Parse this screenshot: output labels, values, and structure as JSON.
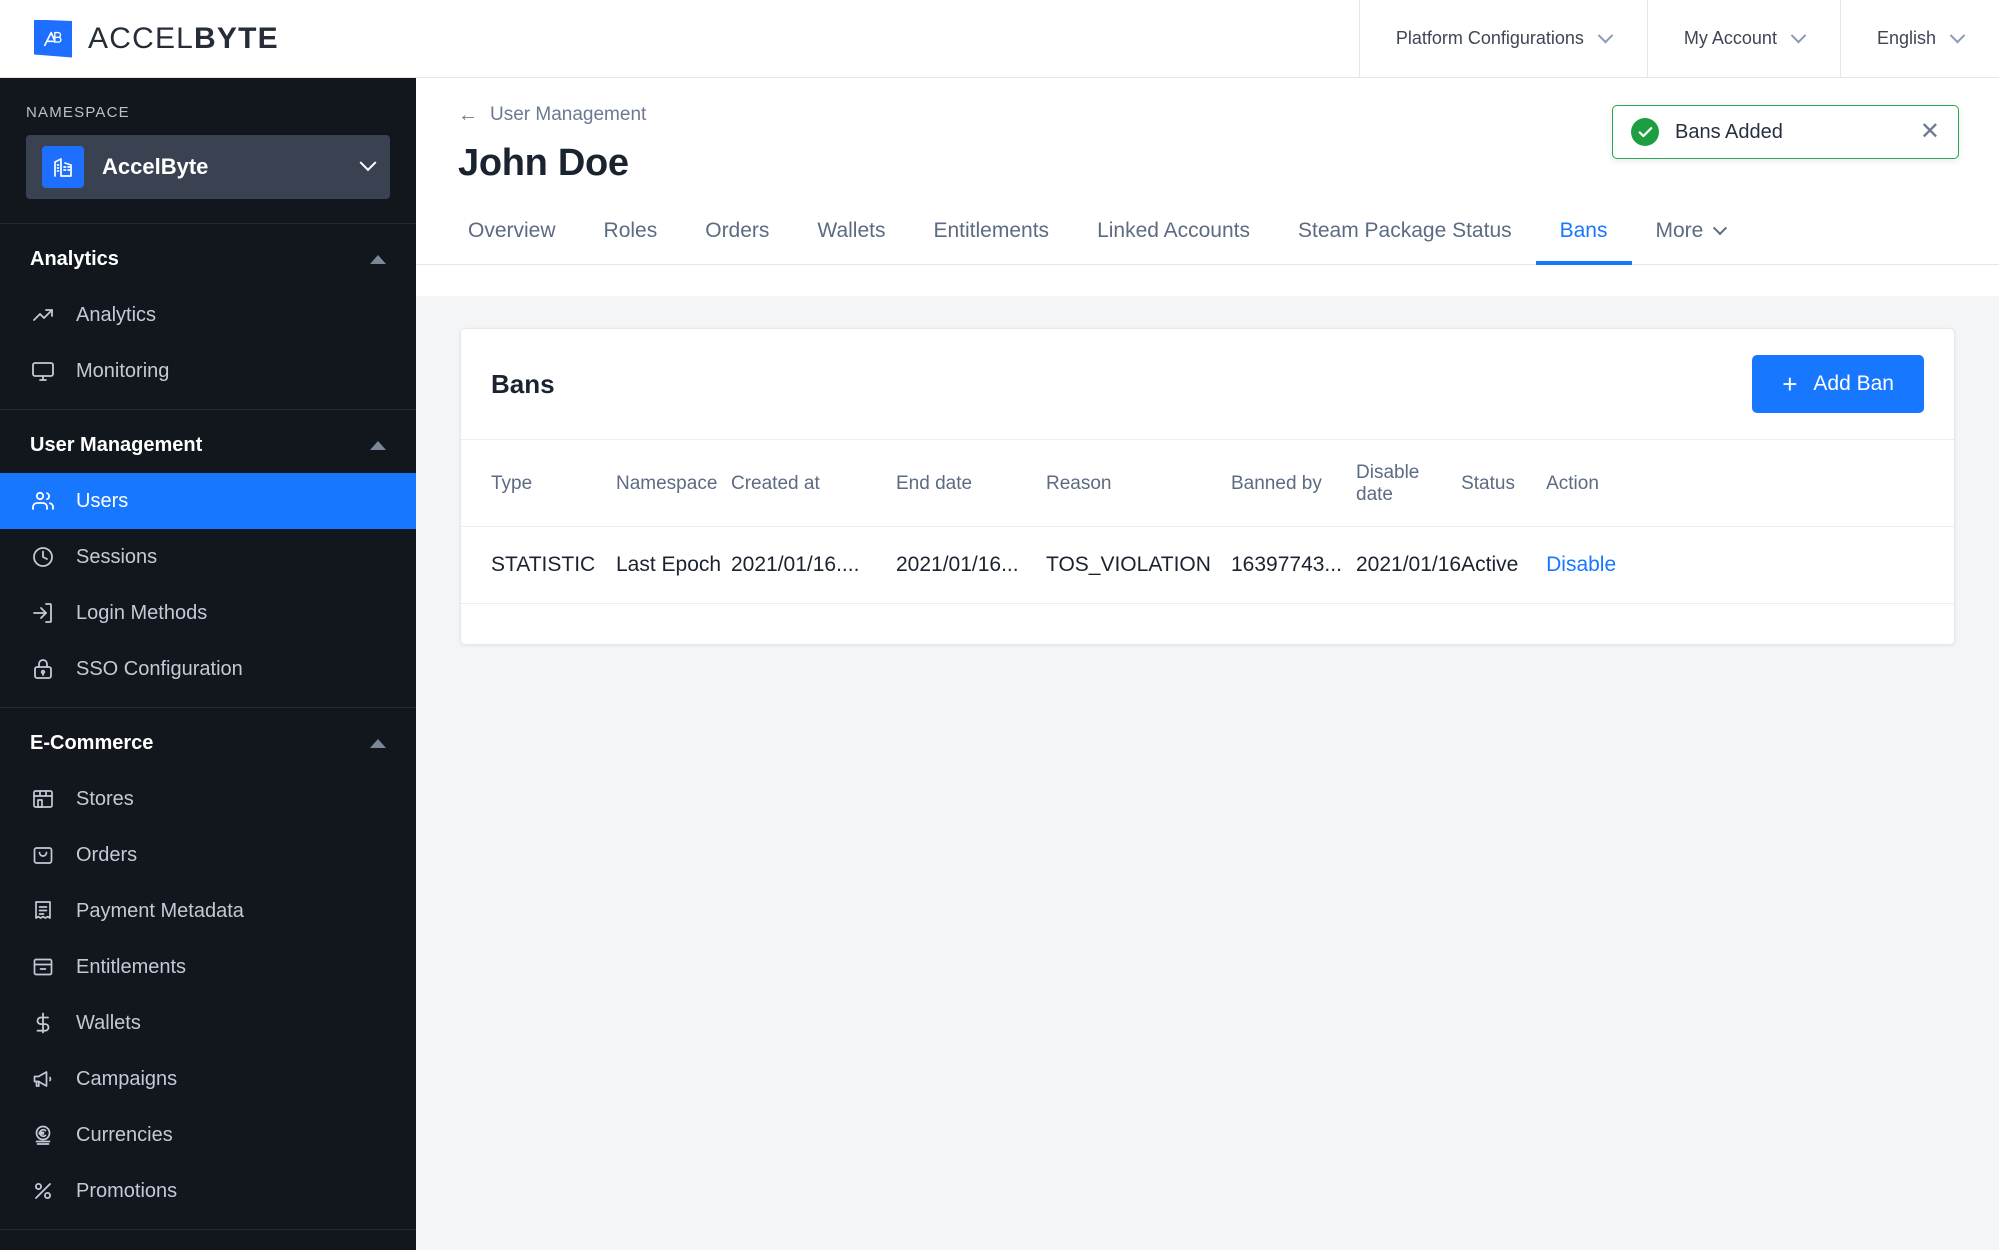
{
  "topbar": {
    "brand_prefix": "ACCEL",
    "brand_suffix": "BYTE",
    "brand_mark": "AB",
    "nav": [
      {
        "label": "Platform Configurations",
        "icon": "chevron-down-icon"
      },
      {
        "label": "My Account",
        "icon": "chevron-down-icon"
      },
      {
        "label": "English",
        "icon": "chevron-down-icon"
      }
    ]
  },
  "sidebar": {
    "namespace_label": "NAMESPACE",
    "namespace_value": "AccelByte",
    "namespace_icon": "building-icon",
    "sections": [
      {
        "title": "Analytics",
        "items": [
          {
            "label": "Analytics",
            "icon": "trending-up-icon",
            "active": false
          },
          {
            "label": "Monitoring",
            "icon": "monitor-icon",
            "active": false
          }
        ]
      },
      {
        "title": "User Management",
        "items": [
          {
            "label": "Users",
            "icon": "users-icon",
            "active": true
          },
          {
            "label": "Sessions",
            "icon": "clock-icon",
            "active": false
          },
          {
            "label": "Login Methods",
            "icon": "login-icon",
            "active": false
          },
          {
            "label": "SSO Configuration",
            "icon": "lock-icon",
            "active": false
          }
        ]
      },
      {
        "title": "E-Commerce",
        "items": [
          {
            "label": "Stores",
            "icon": "store-icon",
            "active": false
          },
          {
            "label": "Orders",
            "icon": "bag-icon",
            "active": false
          },
          {
            "label": "Payment Metadata",
            "icon": "receipt-icon",
            "active": false
          },
          {
            "label": "Entitlements",
            "icon": "archive-icon",
            "active": false
          },
          {
            "label": "Wallets",
            "icon": "dollar-icon",
            "active": false
          },
          {
            "label": "Campaigns",
            "icon": "megaphone-icon",
            "active": false
          },
          {
            "label": "Currencies",
            "icon": "euro-coin-icon",
            "active": false
          },
          {
            "label": "Promotions",
            "icon": "percent-icon",
            "active": false
          }
        ]
      }
    ]
  },
  "page": {
    "breadcrumb": "User Management",
    "breadcrumb_icon": "arrow-left-icon",
    "title": "John Doe",
    "tabs": [
      {
        "label": "Overview",
        "active": false
      },
      {
        "label": "Roles",
        "active": false
      },
      {
        "label": "Orders",
        "active": false
      },
      {
        "label": "Wallets",
        "active": false
      },
      {
        "label": "Entitlements",
        "active": false
      },
      {
        "label": "Linked Accounts",
        "active": false
      },
      {
        "label": "Steam Package Status",
        "active": false
      },
      {
        "label": "Bans",
        "active": true
      }
    ],
    "more_tab": "More"
  },
  "card": {
    "title": "Bans",
    "add_button": "Add Ban",
    "add_button_icon": "plus-icon",
    "columns": [
      "Type",
      "Namespace",
      "Created at",
      "End date",
      "Reason",
      "Banned by",
      "Disable date",
      "Status",
      "Action"
    ],
    "rows": [
      {
        "type": "STATISTIC",
        "namespace": "Last Epoch",
        "created_at": "2021/01/16....",
        "end_date": "2021/01/16...",
        "reason": "TOS_VIOLATION",
        "banned_by": "16397743...",
        "disable_date": "2021/01/16",
        "status": "Active",
        "action": "Disable"
      }
    ]
  },
  "toast": {
    "message": "Bans Added",
    "icon": "check-circle-icon",
    "close_icon": "close-icon",
    "accent": "#2aa84a"
  },
  "colors": {
    "accent_blue": "#1877ff",
    "sidebar_bg": "#12161d",
    "page_bg": "#f4f5f7"
  }
}
